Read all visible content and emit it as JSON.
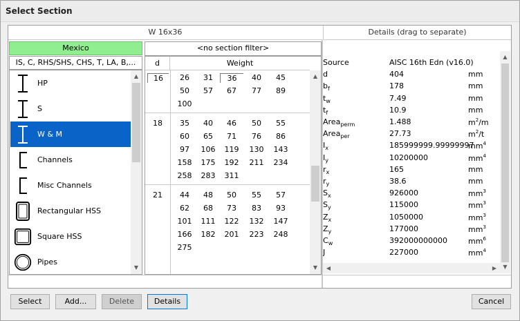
{
  "window": {
    "title": "Select Section"
  },
  "section_header": "W 16x36",
  "details_header": "Details (drag to separate)",
  "country": "Mexico",
  "shape_filter": "IS, C, RHS/SHS, CHS, T, LA, B,...",
  "section_filter": "<no section filter>",
  "columns": {
    "depth": "d",
    "weight": "Weight"
  },
  "categories": [
    {
      "label": "HP",
      "icon": "i-beam-icon",
      "selected": false
    },
    {
      "label": "S",
      "icon": "i-beam-icon",
      "selected": false
    },
    {
      "label": "W & M",
      "icon": "i-beam-icon",
      "selected": true
    },
    {
      "label": "Channels",
      "icon": "channel-icon",
      "selected": false
    },
    {
      "label": "Misc Channels",
      "icon": "channel-icon",
      "selected": false
    },
    {
      "label": "Rectangular HSS",
      "icon": "rectangular-tube-icon",
      "selected": false
    },
    {
      "label": "Square HSS",
      "icon": "square-tube-icon",
      "selected": false
    },
    {
      "label": "Pipes",
      "icon": "pipe-icon",
      "selected": false
    }
  ],
  "groups": [
    {
      "d": "16",
      "weights": [
        "26",
        "31",
        "36",
        "40",
        "45",
        "50",
        "57",
        "67",
        "77",
        "89",
        "100"
      ],
      "selected_weight": "36"
    },
    {
      "d": "18",
      "weights": [
        "35",
        "40",
        "46",
        "50",
        "55",
        "60",
        "65",
        "71",
        "76",
        "86",
        "97",
        "106",
        "119",
        "130",
        "143",
        "158",
        "175",
        "192",
        "211",
        "234",
        "258",
        "283",
        "311"
      ]
    },
    {
      "d": "21",
      "weights": [
        "44",
        "48",
        "50",
        "55",
        "57",
        "62",
        "68",
        "73",
        "83",
        "93",
        "101",
        "111",
        "122",
        "132",
        "147",
        "166",
        "182",
        "201",
        "223",
        "248",
        "275"
      ]
    }
  ],
  "details": [
    {
      "key": "Source",
      "sub": "",
      "value": "AISC 16th Edn (v16.0)",
      "unit": "",
      "usup": ""
    },
    {
      "key": "d",
      "sub": "",
      "value": "404",
      "unit": "mm",
      "usup": ""
    },
    {
      "key": "b",
      "sub": "f",
      "value": "178",
      "unit": "mm",
      "usup": ""
    },
    {
      "key": "t",
      "sub": "w",
      "value": "7.49",
      "unit": "mm",
      "usup": ""
    },
    {
      "key": "t",
      "sub": "f",
      "value": "10.9",
      "unit": "mm",
      "usup": ""
    },
    {
      "key": "Area",
      "sub": "perm",
      "value": "1.488",
      "unit": "m",
      "usup": "2",
      "unit2": "/m"
    },
    {
      "key": "Area",
      "sub": "per",
      "value": "27.73",
      "unit": "m",
      "usup": "2",
      "unit2": "/t"
    },
    {
      "key": "I",
      "sub": "x",
      "value": "185999999.99999997",
      "unit": "mm",
      "usup": "4"
    },
    {
      "key": "I",
      "sub": "y",
      "value": "10200000",
      "unit": "mm",
      "usup": "4"
    },
    {
      "key": "r",
      "sub": "x",
      "value": "165",
      "unit": "mm",
      "usup": ""
    },
    {
      "key": "r",
      "sub": "y",
      "value": "38.6",
      "unit": "mm",
      "usup": ""
    },
    {
      "key": "S",
      "sub": "x",
      "value": "926000",
      "unit": "mm",
      "usup": "3"
    },
    {
      "key": "S",
      "sub": "y",
      "value": "115000",
      "unit": "mm",
      "usup": "3"
    },
    {
      "key": "Z",
      "sub": "x",
      "value": "1050000",
      "unit": "mm",
      "usup": "3"
    },
    {
      "key": "Z",
      "sub": "y",
      "value": "177000",
      "unit": "mm",
      "usup": "3"
    },
    {
      "key": "C",
      "sub": "w",
      "value": "392000000000",
      "unit": "mm",
      "usup": "6"
    },
    {
      "key": "J",
      "sub": "",
      "value": "227000",
      "unit": "mm",
      "usup": "4"
    }
  ],
  "buttons": {
    "select": "Select",
    "add": "Add...",
    "delete": "Delete",
    "details": "Details",
    "cancel": "Cancel"
  }
}
